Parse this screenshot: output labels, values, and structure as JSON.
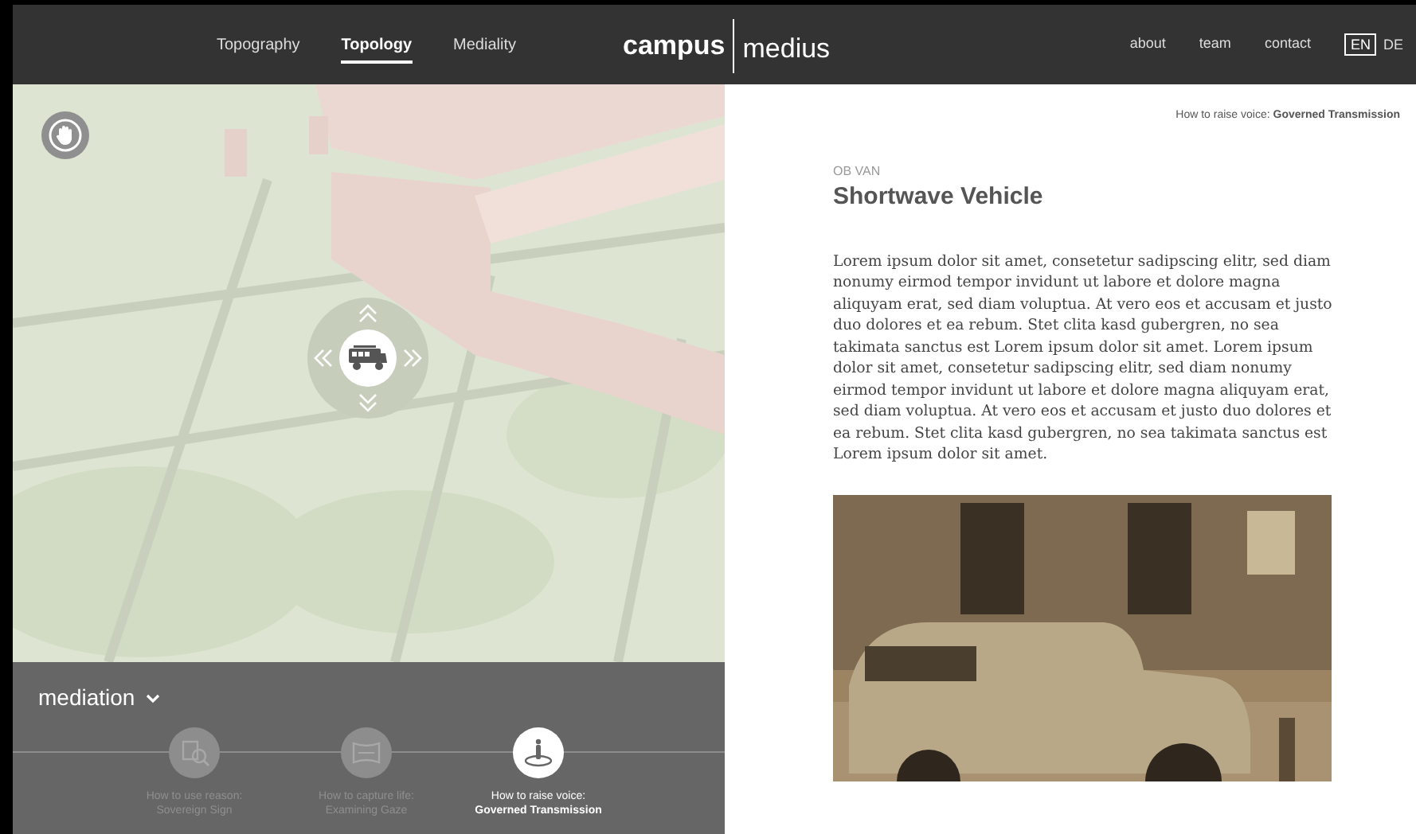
{
  "nav": [
    {
      "label": "Topography",
      "selected": false
    },
    {
      "label": "Topology",
      "selected": true
    },
    {
      "label": "Mediality",
      "selected": false
    }
  ],
  "logo": {
    "left": "campus",
    "right": "medius"
  },
  "links": [
    "about",
    "team",
    "contact"
  ],
  "languages": [
    {
      "label": "EN",
      "selected": true
    },
    {
      "label": "DE",
      "selected": false
    }
  ],
  "mediation": {
    "title": "mediation",
    "stations": [
      {
        "line1": "How to use reason:",
        "line2": "Sovereign Sign",
        "selected": false
      },
      {
        "line1": "How to capture life:",
        "line2": "Examining Gaze",
        "selected": false
      },
      {
        "line1": "How to raise voice:",
        "line2": "Governed Transmission",
        "selected": true
      }
    ]
  },
  "breadcrumb": {
    "prefix": "How to raise voice:",
    "current": "Governed Transmission"
  },
  "article": {
    "overline": "OB VAN",
    "title": "Shortwave Vehicle",
    "body": "Lorem ipsum dolor sit amet, consetetur sadipscing elitr, sed diam nonumy eirmod tempor invidunt ut labore et dolore magna aliquyam erat, sed diam voluptua. At vero eos et accusam et justo duo dolores et ea rebum. Stet clita kasd gubergren, no sea takimata sanctus est Lorem ipsum dolor sit amet. Lorem ipsum dolor sit amet, consetetur sadipscing elitr, sed diam nonumy eirmod tempor invidunt ut labore et dolore magna aliquyam erat, sed diam voluptua. At vero eos et accusam et justo duo dolores et ea rebum. Stet clita kasd gubergren, no sea takimata sanctus est Lorem ipsum dolor sit amet."
  }
}
